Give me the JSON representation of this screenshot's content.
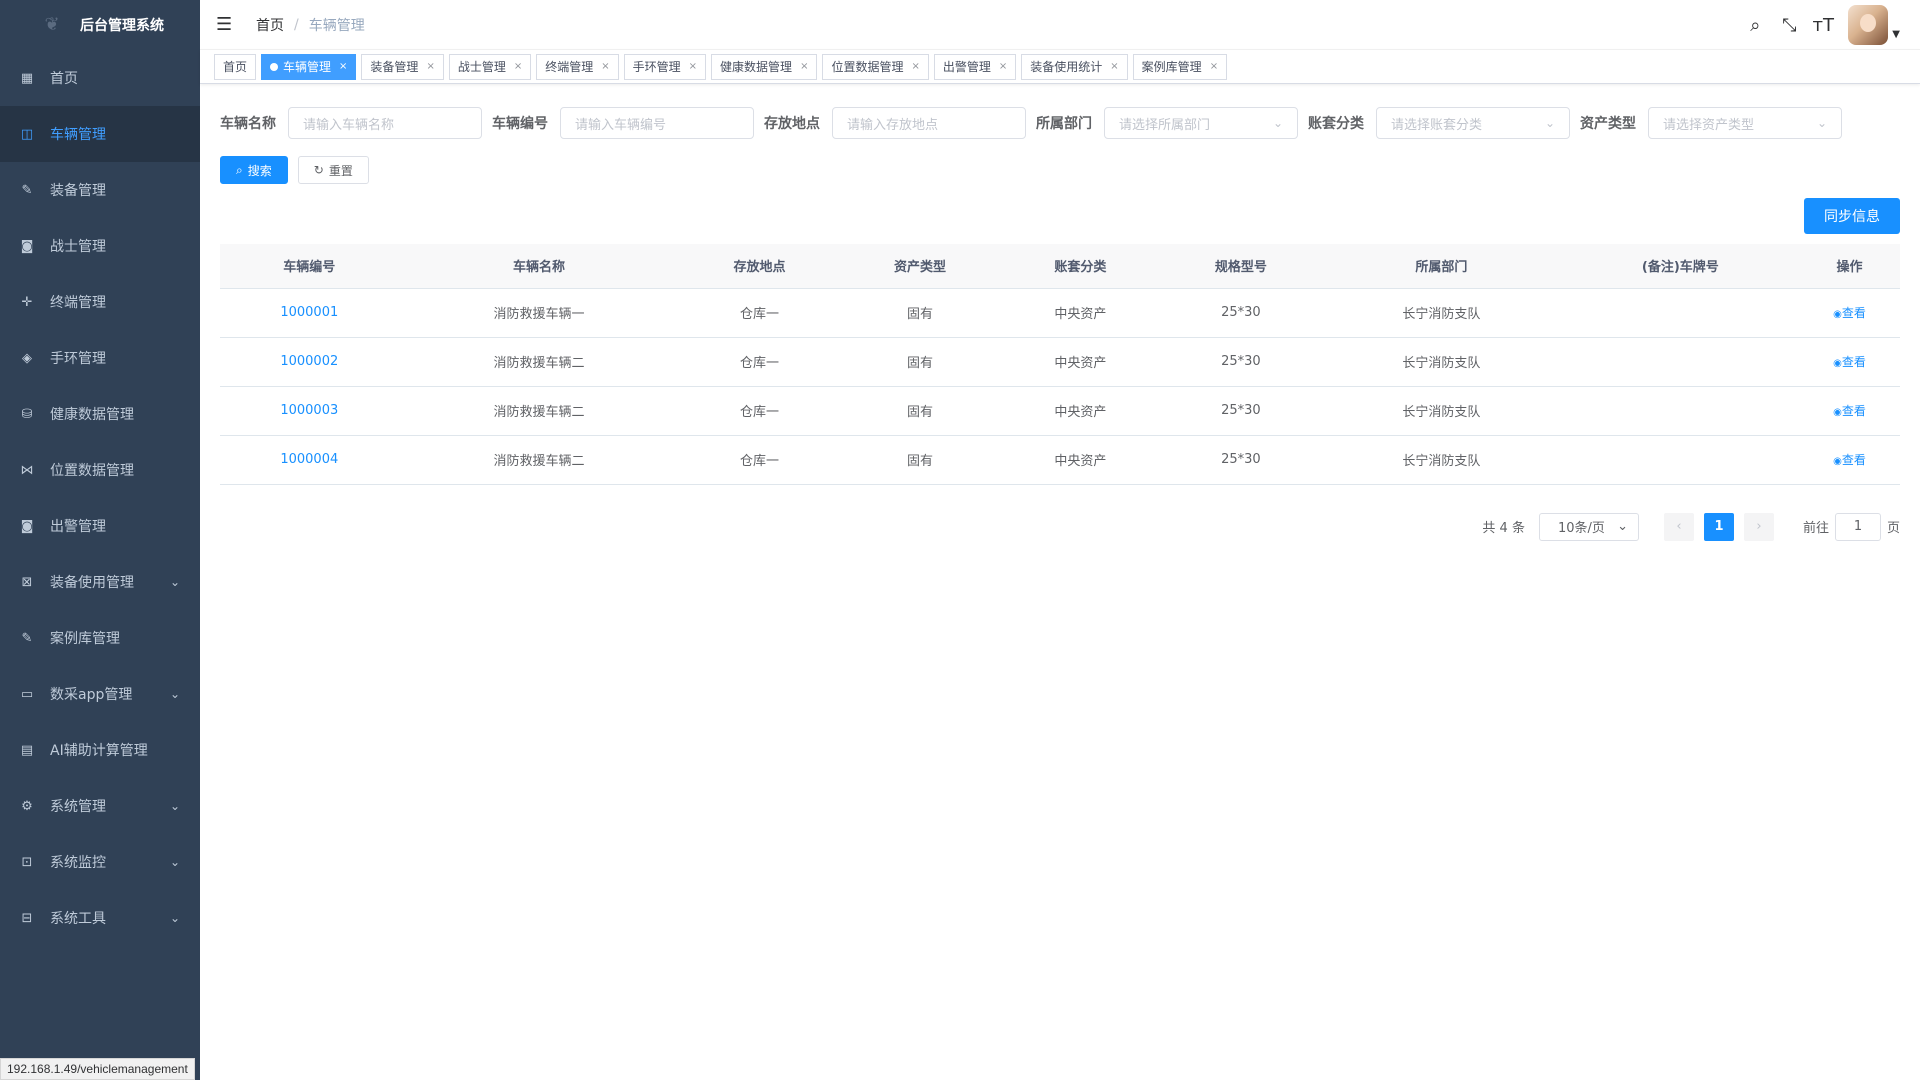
{
  "sidebar": {
    "title": "后台管理系统",
    "items": [
      {
        "label": "首页",
        "icon": "dashboard-icon",
        "glyph": "▦",
        "active": false,
        "arrow": false
      },
      {
        "label": "车辆管理",
        "icon": "vehicle-icon",
        "glyph": "◫",
        "active": true,
        "arrow": false
      },
      {
        "label": "装备管理",
        "icon": "edit-icon",
        "glyph": "✎",
        "active": false,
        "arrow": false
      },
      {
        "label": "战士管理",
        "icon": "soldier-icon",
        "glyph": "◙",
        "active": false,
        "arrow": false
      },
      {
        "label": "终端管理",
        "icon": "move-icon",
        "glyph": "✛",
        "active": false,
        "arrow": false
      },
      {
        "label": "手环管理",
        "icon": "shield-icon",
        "glyph": "◈",
        "active": false,
        "arrow": false
      },
      {
        "label": "健康数据管理",
        "icon": "health-icon",
        "glyph": "⛁",
        "active": false,
        "arrow": false
      },
      {
        "label": "位置数据管理",
        "icon": "location-icon",
        "glyph": "⋈",
        "active": false,
        "arrow": false
      },
      {
        "label": "出警管理",
        "icon": "dispatch-icon",
        "glyph": "◙",
        "active": false,
        "arrow": false
      },
      {
        "label": "装备使用管理",
        "icon": "equipment-usage-icon",
        "glyph": "⊠",
        "active": false,
        "arrow": true
      },
      {
        "label": "案例库管理",
        "icon": "case-library-icon",
        "glyph": "✎",
        "active": false,
        "arrow": false
      },
      {
        "label": "数采app管理",
        "icon": "app-icon",
        "glyph": "▭",
        "active": false,
        "arrow": true
      },
      {
        "label": "AI辅助计算管理",
        "icon": "ai-table-icon",
        "glyph": "▤",
        "active": false,
        "arrow": false
      },
      {
        "label": "系统管理",
        "icon": "system-gear-icon",
        "glyph": "⚙",
        "active": false,
        "arrow": true
      },
      {
        "label": "系统监控",
        "icon": "monitor-icon",
        "glyph": "⊡",
        "active": false,
        "arrow": true
      },
      {
        "label": "系统工具",
        "icon": "toolbox-icon",
        "glyph": "⊟",
        "active": false,
        "arrow": true
      }
    ]
  },
  "navbar": {
    "breadcrumb_home": "首页",
    "breadcrumb_sep": "/",
    "breadcrumb_current": "车辆管理"
  },
  "tags": [
    {
      "label": "首页",
      "active": false,
      "closable": false
    },
    {
      "label": "车辆管理",
      "active": true,
      "closable": true
    },
    {
      "label": "装备管理",
      "active": false,
      "closable": true
    },
    {
      "label": "战士管理",
      "active": false,
      "closable": true
    },
    {
      "label": "终端管理",
      "active": false,
      "closable": true
    },
    {
      "label": "手环管理",
      "active": false,
      "closable": true
    },
    {
      "label": "健康数据管理",
      "active": false,
      "closable": true
    },
    {
      "label": "位置数据管理",
      "active": false,
      "closable": true
    },
    {
      "label": "出警管理",
      "active": false,
      "closable": true
    },
    {
      "label": "装备使用统计",
      "active": false,
      "closable": true
    },
    {
      "label": "案例库管理",
      "active": false,
      "closable": true
    }
  ],
  "search_form": {
    "fields": [
      {
        "label": "车辆名称",
        "placeholder": "请输入车辆名称",
        "select": false
      },
      {
        "label": "车辆编号",
        "placeholder": "请输入车辆编号",
        "select": false
      },
      {
        "label": "存放地点",
        "placeholder": "请输入存放地点",
        "select": false
      },
      {
        "label": "所属部门",
        "placeholder": "请选择所属部门",
        "select": true
      },
      {
        "label": "账套分类",
        "placeholder": "请选择账套分类",
        "select": true
      },
      {
        "label": "资产类型",
        "placeholder": "请选择资产类型",
        "select": true
      }
    ],
    "search_label": "搜索",
    "reset_label": "重置"
  },
  "sync_label": "同步信息",
  "table": {
    "columns": [
      "车辆编号",
      "车辆名称",
      "存放地点",
      "资产类型",
      "账套分类",
      "规格型号",
      "所属部门",
      "(备注)车牌号",
      "操作"
    ],
    "view_label": "查看",
    "rows": [
      {
        "id": "1000001",
        "name": "消防救援车辆一",
        "place": "仓库一",
        "asset": "固有",
        "account": "中央资产",
        "spec": "25*30",
        "dept": "长宁消防支队",
        "plate": ""
      },
      {
        "id": "1000002",
        "name": "消防救援车辆二",
        "place": "仓库一",
        "asset": "固有",
        "account": "中央资产",
        "spec": "25*30",
        "dept": "长宁消防支队",
        "plate": ""
      },
      {
        "id": "1000003",
        "name": "消防救援车辆二",
        "place": "仓库一",
        "asset": "固有",
        "account": "中央资产",
        "spec": "25*30",
        "dept": "长宁消防支队",
        "plate": ""
      },
      {
        "id": "1000004",
        "name": "消防救援车辆二",
        "place": "仓库一",
        "asset": "固有",
        "account": "中央资产",
        "spec": "25*30",
        "dept": "长宁消防支队",
        "plate": ""
      }
    ]
  },
  "pagination": {
    "total": "共 4 条",
    "page_size": "10条/页",
    "current_page": "1",
    "goto_label": "前往",
    "goto_value": "1",
    "page_unit": "页"
  },
  "status_url": "192.168.1.49/vehiclemanagement"
}
